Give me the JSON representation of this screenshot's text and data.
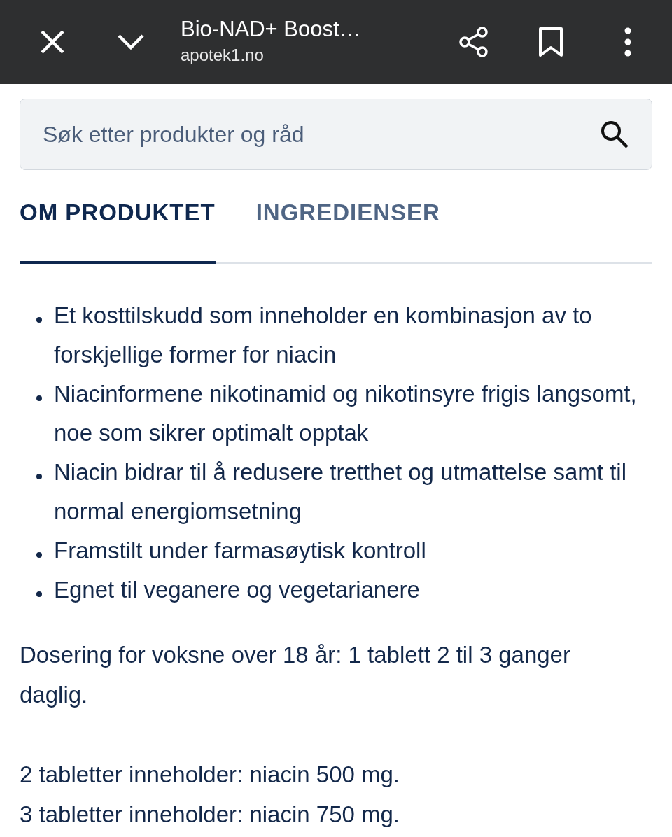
{
  "browser_bar": {
    "title": "Bio-NAD+ Boost…",
    "url": "apotek1.no"
  },
  "search": {
    "placeholder": "Søk etter produkter og råd"
  },
  "tabs": [
    {
      "label": "OM PRODUKTET",
      "selected": true
    },
    {
      "label": "INGREDIENSER",
      "selected": false
    }
  ],
  "bullets": [
    "Et kosttilskudd som inneholder en kombinasjon av to forskjellige former for niacin",
    "Niacinformene nikotinamid og nikotinsyre frigis langsomt, noe som sikrer optimalt opptak",
    "Niacin bidrar til å redusere tretthet og utmattelse samt til normal energiomsetning",
    "Framstilt under farmasøytisk kontroll",
    "Egnet til veganere og vegetarianere"
  ],
  "paragraphs": [
    [
      "Dosering for voksne over 18 år: 1 tablett 2 til 3 ganger daglig."
    ],
    [
      "2 tabletter inneholder: niacin 500 mg.",
      "3 tabletter inneholder: niacin 750 mg."
    ]
  ]
}
